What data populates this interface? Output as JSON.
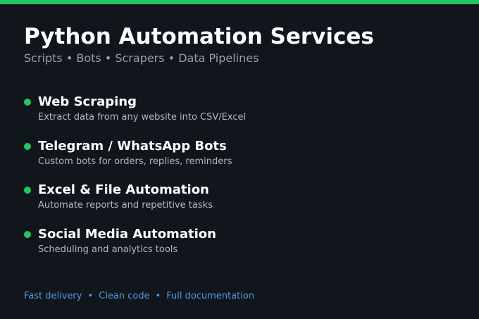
{
  "header": {
    "title": "Python Automation Services",
    "subtitle": "Scripts • Bots • Scrapers • Data Pipelines"
  },
  "services": [
    {
      "title": "Web Scraping",
      "description": "Extract data from any website into CSV/Excel"
    },
    {
      "title": "Telegram / WhatsApp Bots",
      "description": "Custom bots for orders, replies, reminders"
    },
    {
      "title": "Excel & File Automation",
      "description": "Automate reports and repetitive tasks"
    },
    {
      "title": "Social Media Automation",
      "description": "Scheduling and analytics tools"
    }
  ],
  "footer": {
    "items": [
      "Fast delivery",
      "Clean code",
      "Full documentation"
    ],
    "separator": "•"
  },
  "colors": {
    "background": "#11151c",
    "accent": "#22c55e",
    "link": "#4f9be0"
  }
}
